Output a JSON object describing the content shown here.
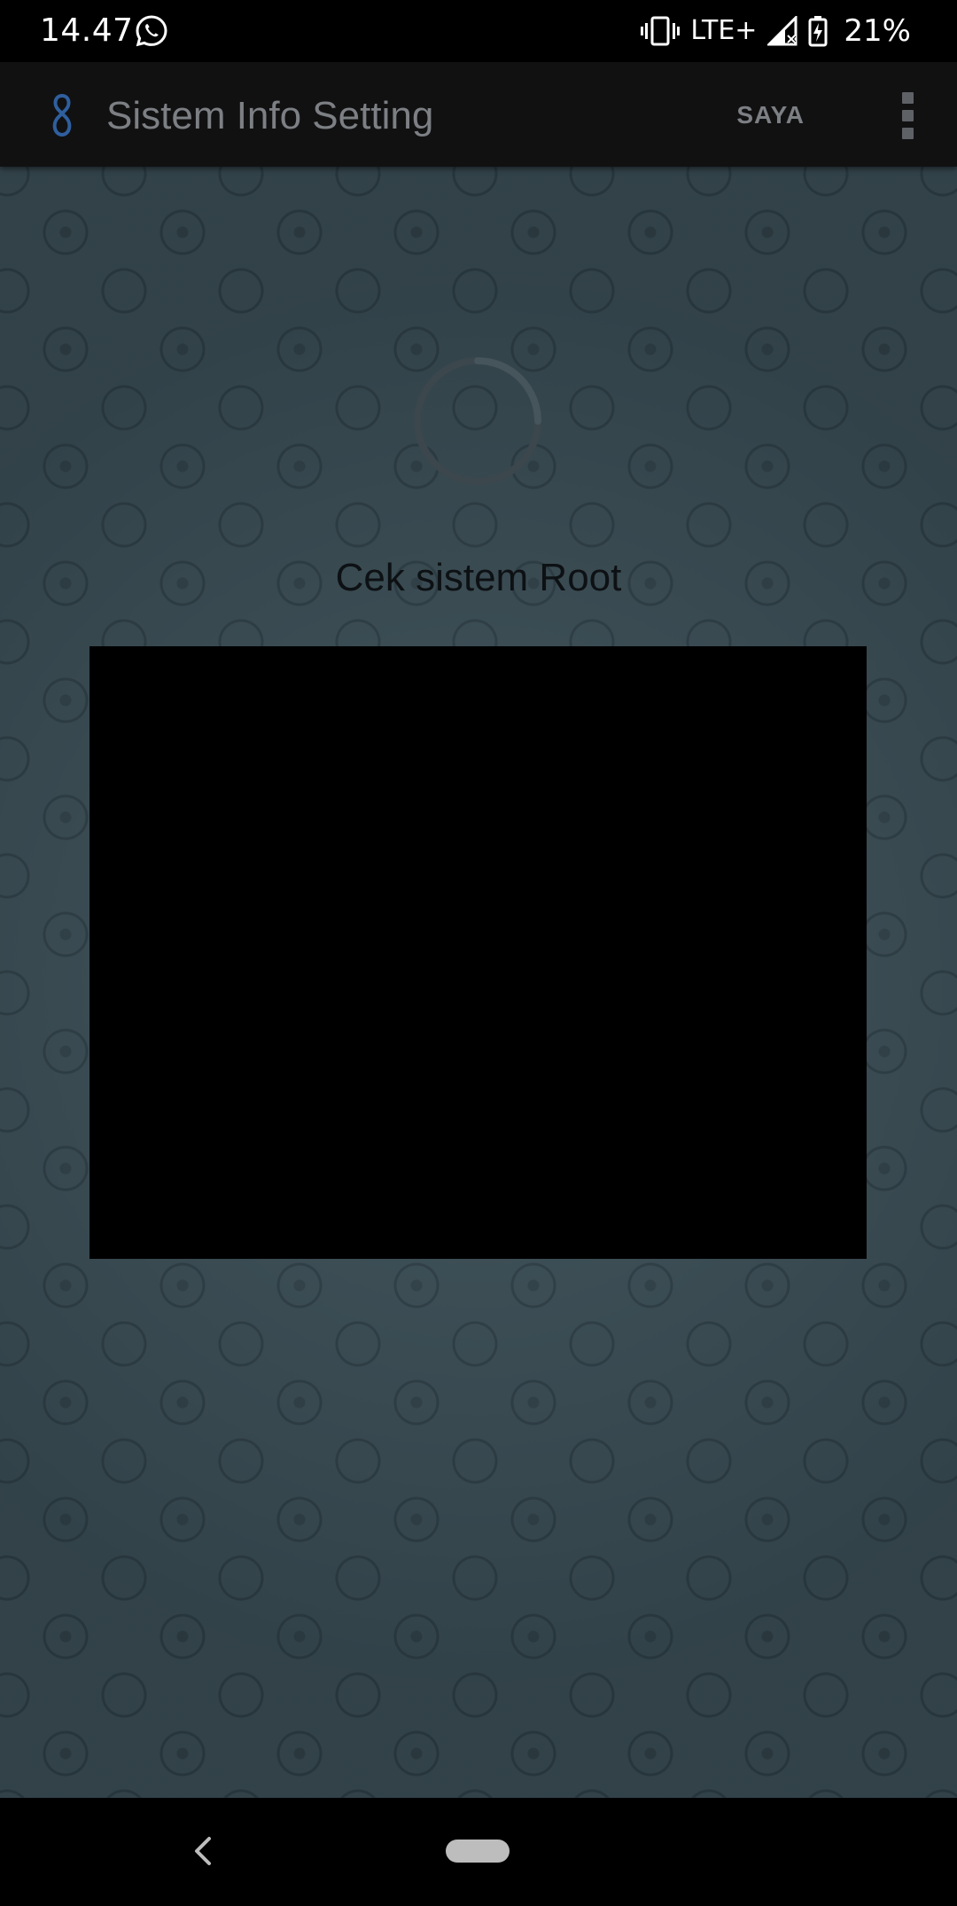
{
  "status_bar": {
    "time": "14.47",
    "network": "LTE+",
    "battery": "21%",
    "icons": [
      "whatsapp-icon",
      "vibrate-icon",
      "signal-icon",
      "battery-charging-icon"
    ]
  },
  "app_bar": {
    "title": "Sistem Info Setting",
    "action_label": "SAYA",
    "logo_icon": "app-logo-icon",
    "menu_icon": "more-vert-icon"
  },
  "content": {
    "message": "Cek sistem Root",
    "spinner_icon": "loading-spinner-icon"
  },
  "navigation": {
    "back_icon": "back-icon",
    "home_icon": "home-pill-icon"
  },
  "colors": {
    "status_bar": "#000000",
    "app_bar": "#111112",
    "title_text": "#7c7f83",
    "content_background": "#3a4d55",
    "message_text": "#0d1114",
    "ad_box": "#000000",
    "nav_bar": "#000000"
  }
}
